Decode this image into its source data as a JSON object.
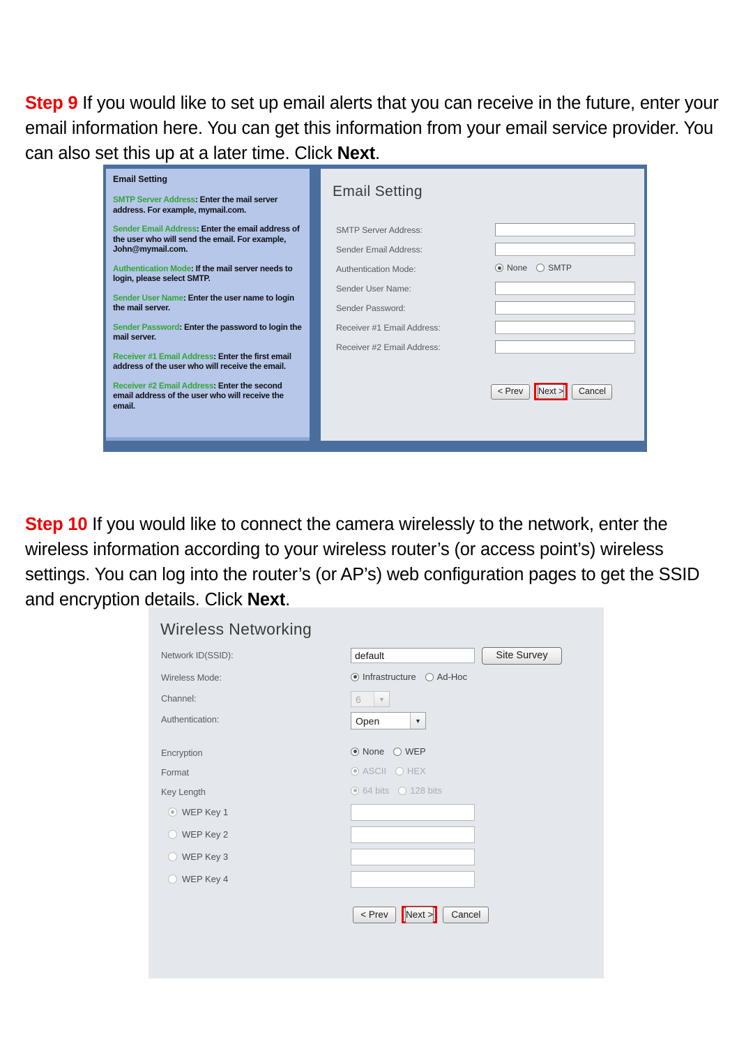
{
  "steps": [
    {
      "label": "Step 9",
      "body_part1": " If you would like to set up email alerts that you can receive in the future, enter your email information here.  You can get this information from your email service provider.  You can also set this up at a later time. Click ",
      "bold_word": "Next",
      "body_part2": "."
    },
    {
      "label": "Step 10",
      "body_part1": " If you would like to connect the camera wirelessly to the network, enter the wireless information according to your wireless router’s (or access point’s) wireless settings.  You can log into the router’s (or AP’s) web configuration pages to get the SSID and encryption details.  Click ",
      "bold_word": "Next",
      "body_part2": "."
    }
  ],
  "email_setting": {
    "left_panel": {
      "title": "Email Setting",
      "items": [
        {
          "key": "SMTP Server Address",
          "text": ": Enter the mail server address. For example, mymail.com."
        },
        {
          "key": "Sender Email Address",
          "text": ": Enter the email address of the user who will send the email. For example, John@mymail.com."
        },
        {
          "key": "Authentication Mode",
          "text": ": If the mail server needs to login, please select SMTP."
        },
        {
          "key": "Sender User Name",
          "text": ": Enter the user name to login the mail server."
        },
        {
          "key": "Sender Password",
          "text": ": Enter the password to login the mail server."
        },
        {
          "key": "Receiver #1 Email Address",
          "text": ": Enter the first email address of the user who will receive the email."
        },
        {
          "key": "Receiver #2 Email Address",
          "text": ": Enter the second email address of the user who will receive the email."
        }
      ]
    },
    "heading": "Email Setting",
    "fields": [
      {
        "label": "SMTP Server Address:",
        "value": ""
      },
      {
        "label": "Sender Email Address:",
        "value": ""
      },
      {
        "label": "Sender User Name:",
        "value": ""
      },
      {
        "label": "Sender Password:",
        "value": ""
      },
      {
        "label": "Receiver #1 Email Address:",
        "value": ""
      },
      {
        "label": "Receiver #2 Email Address:",
        "value": ""
      }
    ],
    "auth_mode": {
      "label": "Authentication Mode:",
      "option_none": "None",
      "option_smtp": "SMTP",
      "selected": "None"
    },
    "buttons": {
      "prev": "< Prev",
      "next": "Next >",
      "cancel": "Cancel",
      "highlighted": "Next >"
    }
  },
  "wireless_networking": {
    "heading": "Wireless Networking",
    "ssid": {
      "label": "Network ID(SSID):",
      "value": "default",
      "site_survey_button": "Site Survey"
    },
    "wireless_mode": {
      "label": "Wireless Mode:",
      "option_infrastructure": "Infrastructure",
      "option_adhoc": "Ad-Hoc",
      "selected": "Infrastructure"
    },
    "channel": {
      "label": "Channel:",
      "value": "6",
      "disabled": true
    },
    "authentication": {
      "label": "Authentication:",
      "value": "Open",
      "disabled": false
    },
    "encryption": {
      "label": "Encryption",
      "option_none": "None",
      "option_wep": "WEP",
      "selected": "None"
    },
    "format": {
      "label": "Format",
      "option_ascii": "ASCII",
      "option_hex": "HEX",
      "selected": "ASCII",
      "disabled": true
    },
    "key_length": {
      "label": "Key Length",
      "option_64": "64 bits",
      "option_128": "128 bits",
      "selected": "64 bits",
      "disabled": true
    },
    "wep_keys": [
      {
        "label": "WEP Key 1",
        "value": "",
        "selected": true
      },
      {
        "label": "WEP Key 2",
        "value": "",
        "selected": false
      },
      {
        "label": "WEP Key 3",
        "value": "",
        "selected": false
      },
      {
        "label": "WEP Key 4",
        "value": "",
        "selected": false
      }
    ],
    "buttons": {
      "prev": "< Prev",
      "next": "Next >",
      "cancel": "Cancel",
      "highlighted": "Next >"
    }
  },
  "colors": {
    "step_label": "#ee0000",
    "highlight_box": "#ee0000",
    "left_panel_bg": "#b6c7ea",
    "left_panel_key": "#35a535",
    "panel_bg": "#e4e8ec",
    "frame": "#4a6f9e"
  }
}
